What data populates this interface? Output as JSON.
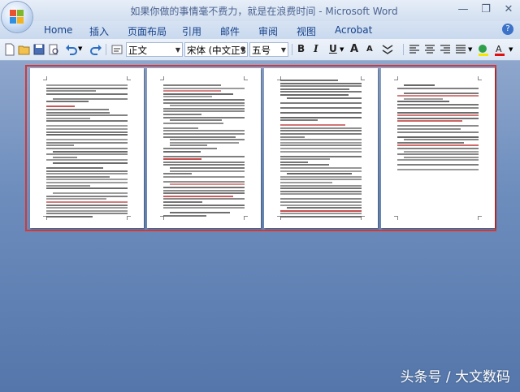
{
  "window": {
    "title": "如果你做的事情毫不费力，就是在浪费时间 - Microsoft Word",
    "controls": [
      "—",
      "❐",
      "✕"
    ]
  },
  "ribbon": {
    "tabs": [
      "Home",
      "插入",
      "页面布局",
      "引用",
      "邮件",
      "审阅",
      "视图",
      "Acrobat"
    ],
    "help": "?"
  },
  "toolbar": {
    "style_value": "正文",
    "font_value": "宋体 (中文正3",
    "size_value": "五号",
    "bold": "B",
    "italic": "I",
    "underline": "U",
    "grow_font": "A",
    "shrink_font": "A"
  },
  "document": {
    "page_count": 4
  },
  "watermark": "头条号 / 大文数码",
  "colors": {
    "selection_border": "#d13a3a",
    "tab_text": "#15428b",
    "doc_background": "#5676a8"
  }
}
